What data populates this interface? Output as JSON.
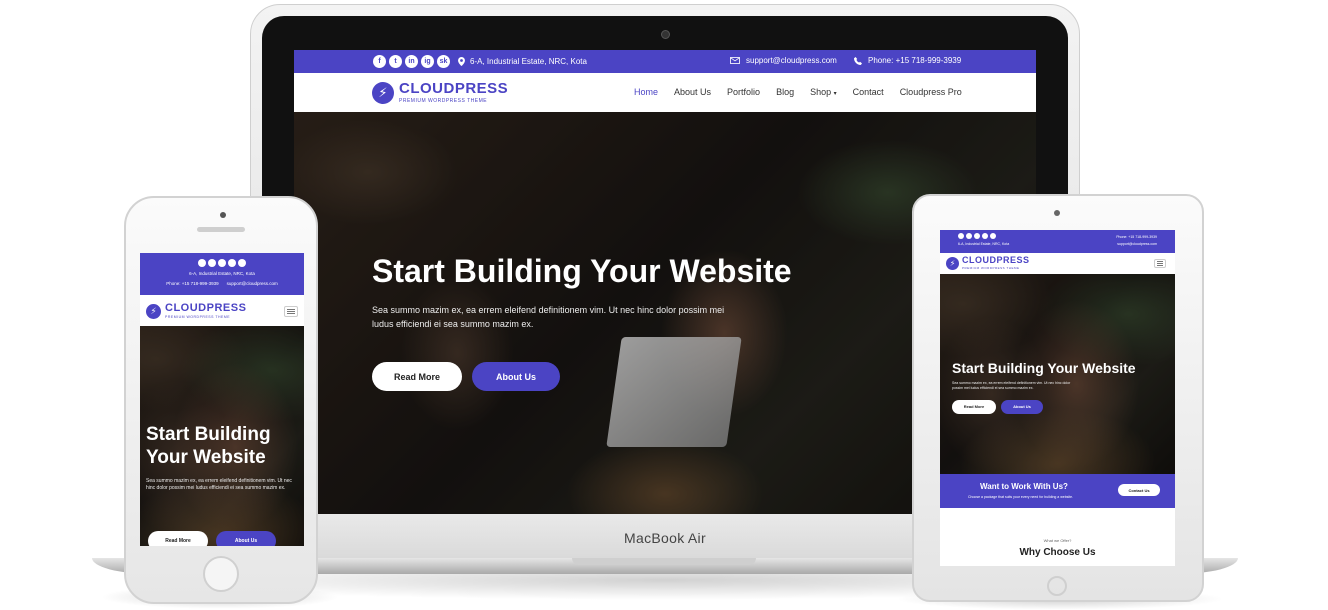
{
  "colors": {
    "brand": "#4b44c4",
    "hero_overlay": "#1d1916"
  },
  "device_labels": {
    "laptop": "MacBook Air"
  },
  "site": {
    "topbar": {
      "social_icons": [
        "f",
        "t",
        "in",
        "ig",
        "sk"
      ],
      "address": "6-A, Industrial Estate, NRC, Kota",
      "email": "support@cloudpress.com",
      "phone": "Phone: +15 718-999-3939"
    },
    "logo": {
      "name_part1": "CLOUD",
      "name_part2": "PRESS",
      "tagline": "PREMIUM WORDPRESS THEME",
      "mark": "⚡"
    },
    "menu": [
      "Home",
      "About Us",
      "Portfolio",
      "Blog",
      "Shop",
      "Contact",
      "Cloudpress Pro"
    ],
    "hero": {
      "title": "Start Building Your Website",
      "description": "Sea summo mazim ex, ea errem eleifend definitionem vim. Ut nec hinc dolor possim mei ludus efficiendi ei sea summo mazim ex.",
      "button_read_more": "Read More",
      "button_about": "About Us"
    }
  },
  "phone": {
    "address": "6-A, Industrial Estate, NRC, Kota",
    "phone": "Phone: +15 718-999-3939",
    "email": "support@cloudpress.com",
    "hero_title_line1": "Start Building",
    "hero_title_line2": "Your Website",
    "hero_desc": "Sea summo mazim ex, ea errem eleifend definitionem vim. Ut nec hinc dolor possim mei ludus efficiendi ei sea summo mazim ex.",
    "button_read_more": "Read More",
    "button_about": "About Us"
  },
  "tablet": {
    "address": "6-A, Industrial Estate, NRC, Kota",
    "phone": "Phone: +15 718-999-3939",
    "email": "support@cloudpress.com",
    "hero_title": "Start Building Your Website",
    "hero_desc": "Sea summo mazim ex, ea errem eleifend definitionem vim. Ut nec hinc dolor possim mei ludus efficiendi ei sea summo mazim ex.",
    "button_read_more": "Read More",
    "button_about": "About Us",
    "cta_title": "Want to Work With Us?",
    "cta_desc": "Choose a package that suits your every need for building a website.",
    "cta_button": "Contact Us",
    "why_kicker": "What we Offer?",
    "why_title": "Why Choose Us"
  }
}
